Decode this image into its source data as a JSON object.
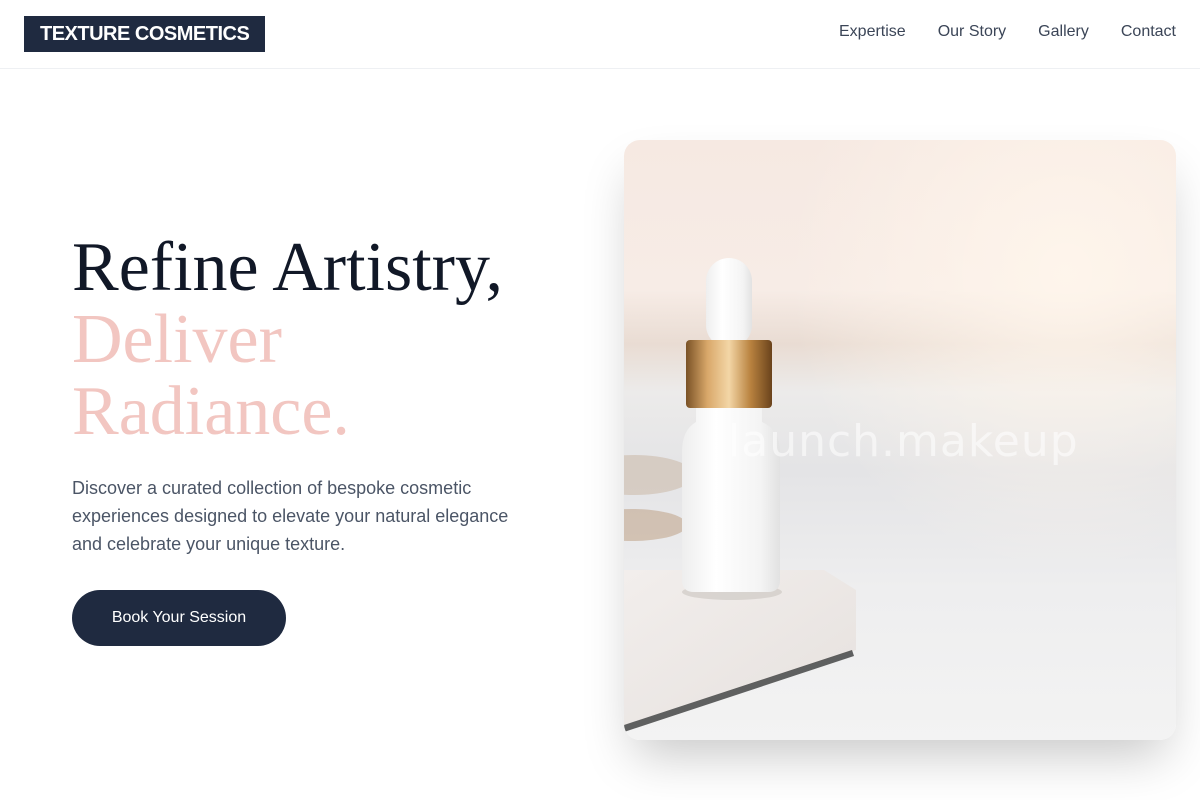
{
  "header": {
    "logo": "TEXTURE COSMETICS",
    "nav": [
      "Expertise",
      "Our Story",
      "Gallery",
      "Contact"
    ]
  },
  "hero": {
    "title_line1": "Refine Artistry,",
    "title_line2": "Deliver",
    "title_line3": "Radiance.",
    "description": "Discover a curated collection of bespoke cosmetic experiences designed to elevate your natural elegance and celebrate your unique texture.",
    "cta": "Book Your Session",
    "image_watermark": "launch.makeup"
  },
  "colors": {
    "navy": "#1f2a40",
    "blush": "#f2c6c1",
    "text_dark": "#111827",
    "text_muted": "#4b5566"
  }
}
